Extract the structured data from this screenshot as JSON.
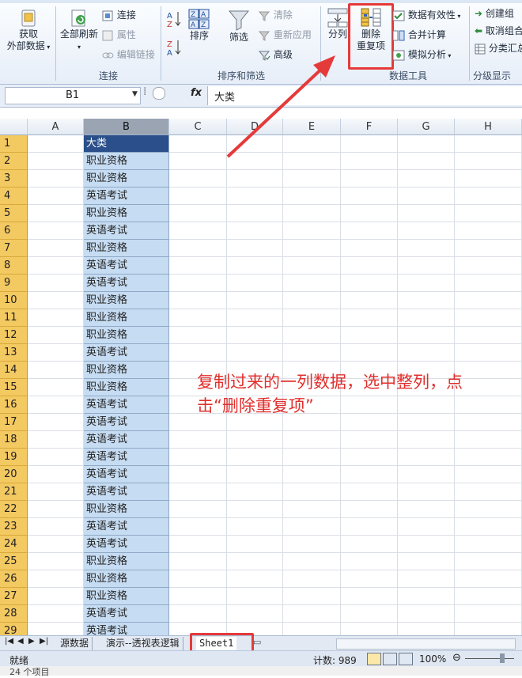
{
  "ribbon": {
    "get_external": [
      "获取",
      "外部数据"
    ],
    "refresh_all": "全部刷新",
    "connections": "连接",
    "properties": "属性",
    "edit_links": "编辑链接",
    "group_connections": "连接",
    "sort": "排序",
    "filter": "筛选",
    "clear": "清除",
    "reapply": "重新应用",
    "advanced": "高级",
    "group_sort_filter": "排序和筛选",
    "text_to_columns": "分列",
    "remove_duplicates": [
      "删除",
      "重复项"
    ],
    "data_validation": "数据有效性",
    "consolidate": "合并计算",
    "what_if": "模拟分析",
    "group_data_tools": "数据工具",
    "group_btn": "创建组",
    "ungroup": "取消组合",
    "subtotal": "分类汇总",
    "group_outline": "分级显示"
  },
  "formula": {
    "name_box": "B1",
    "fx": "fx",
    "value": "大类"
  },
  "grid": {
    "columns": [
      "A",
      "B",
      "C",
      "D",
      "E",
      "F",
      "G",
      "H"
    ],
    "rows": [
      "1",
      "2",
      "3",
      "4",
      "5",
      "6",
      "7",
      "8",
      "9",
      "10",
      "11",
      "12",
      "13",
      "14",
      "15",
      "16",
      "17",
      "18",
      "19",
      "20",
      "21",
      "22",
      "23",
      "24",
      "25",
      "26",
      "27",
      "28",
      "29"
    ],
    "col_b": [
      "大类",
      "职业资格",
      "职业资格",
      "英语考试",
      "职业资格",
      "英语考试",
      "职业资格",
      "英语考试",
      "英语考试",
      "职业资格",
      "职业资格",
      "职业资格",
      "英语考试",
      "职业资格",
      "职业资格",
      "英语考试",
      "英语考试",
      "英语考试",
      "英语考试",
      "英语考试",
      "英语考试",
      "职业资格",
      "英语考试",
      "英语考试",
      "职业资格",
      "职业资格",
      "职业资格",
      "英语考试",
      "英语考试"
    ]
  },
  "annotation": "复制过来的一列数据，选中整列，点击“删除重复项”",
  "sheets": [
    "源数据",
    "演示--透视表逻辑",
    "Sheet1"
  ],
  "status": {
    "ready": "就绪",
    "count": "计数: 989",
    "zoom": "100%",
    "items": "24 个项目"
  },
  "colors": {
    "accent": "#e53a3a",
    "selection": "#c6dcf2",
    "active_cell": "#2a4f8a"
  }
}
